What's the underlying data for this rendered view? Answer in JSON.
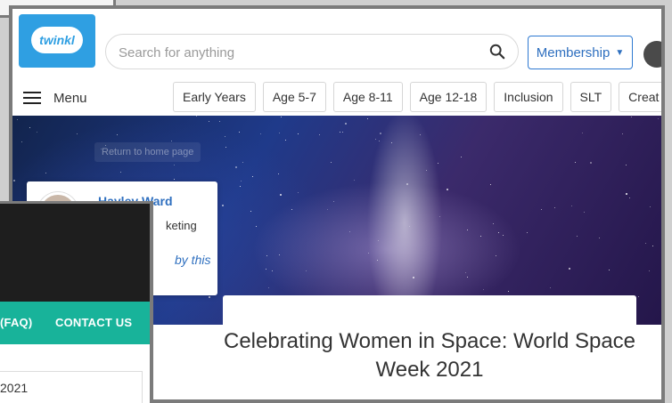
{
  "header": {
    "logo_text": "twinkl",
    "search_placeholder": "Search for anything",
    "membership_label": "Membership",
    "membership_caret": "▼"
  },
  "nav": {
    "menu_label": "Menu",
    "tabs": [
      "Early Years",
      "Age 5-7",
      "Age 8-11",
      "Age 12-18",
      "Inclusion",
      "SLT",
      "Creat"
    ]
  },
  "hero": {
    "return_home": "Return to home page"
  },
  "author": {
    "name": "Hayley Ward",
    "role": "keting",
    "link": "by this"
  },
  "article": {
    "title": "Celebrating Women in Space: World Space Week 2021"
  },
  "side_window": {
    "faq_text": "(FAQ)",
    "contact_text": "CONTACT US",
    "field_text": "2021"
  },
  "colors": {
    "twinkl_blue": "#2f9fe2",
    "link_blue": "#2e6fbf",
    "teal": "#18b39a",
    "dark": "#1e1e1e"
  }
}
